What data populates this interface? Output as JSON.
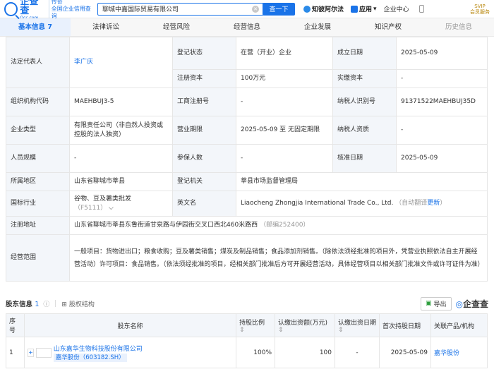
{
  "header": {
    "logo": "企查查",
    "logo_sub": "Qcc.com",
    "logo_side1": "传奇",
    "logo_side2": "全国企业信用查询",
    "search_value": "聊城中嘉国际贸易有限公司",
    "search_btn": "查一下",
    "nav": [
      "知彼阿尔法",
      "应用",
      "企业中心"
    ],
    "vip1": "SVIP",
    "vip2": "会员服务"
  },
  "tabs": [
    "基本信息 7",
    "法律诉讼",
    "经营风险",
    "经营信息",
    "企业发展",
    "知识产权",
    "历史信息"
  ],
  "info": {
    "legal_rep_k": "法定代表人",
    "legal_rep_v": "李广庆",
    "reg_status_k": "登记状态",
    "reg_status_v": "在营（开业）企业",
    "est_date_k": "成立日期",
    "est_date_v": "2025-05-09",
    "reg_cap_k": "注册资本",
    "reg_cap_v": "100万元",
    "paid_cap_k": "实缴资本",
    "paid_cap_v": "-",
    "org_code_k": "组织机构代码",
    "org_code_v": "MAEHBUJ3-5",
    "biz_reg_k": "工商注册号",
    "biz_reg_v": "-",
    "tax_id_k": "纳税人识别号",
    "tax_id_v": "91371522MAEHBUJ35D",
    "type_k": "企业类型",
    "type_v": "有限责任公司（非自然人投资或控股的法人独资）",
    "term_k": "营业期限",
    "term_v": "2025-05-09 至 无固定期限",
    "taxpayer_k": "纳税人资质",
    "taxpayer_v": "-",
    "staff_k": "人员规模",
    "staff_v": "-",
    "insured_k": "参保人数",
    "insured_v": "-",
    "approve_k": "核准日期",
    "approve_v": "2025-05-09",
    "region_k": "所属地区",
    "region_v": "山东省聊城市莘县",
    "authority_k": "登记机关",
    "authority_v": "莘县市场监督管理局",
    "industry_k": "国标行业",
    "industry_v": "谷物、豆及薯类批发",
    "industry_code": "（F5111）",
    "en_name_k": "英文名",
    "en_name_v": "Liaocheng Zhongjia International Trade Co., Ltd.",
    "en_note": "（自动翻译",
    "en_update": "更新",
    "en_close": "）",
    "address_k": "注册地址",
    "address_v": "山东省聊城市莘县东鲁街道甘泉路与伊园街交叉口西北460米路西",
    "postcode": "（邮编252400）",
    "scope_k": "经营范围",
    "scope_v": "一般项目：货物进出口；粮食收购；豆及薯类销售；煤炭及制品销售；食品添加剂销售。（除依法须经批准的项目外，凭营业执照依法自主开展经营活动）许可项目：食品销售。（依法须经批准的项目，经相关部门批准后方可开展经营活动，具体经营项目以相关部门批准文件或许可证件为准）"
  },
  "shareholders": {
    "title": "股东信息",
    "count": "1",
    "struct": "股权结构",
    "export": "导出",
    "brand": "企查查",
    "cols": [
      "序号",
      "股东名称",
      "持股比例",
      "认缴出资额(万元)",
      "认缴出资日期",
      "首次持股日期",
      "关联产品/机构"
    ],
    "rows": [
      {
        "no": "1",
        "name": "山东嘉华生物科技股份有限公司",
        "tag": "嘉华股份（603182.SH）",
        "ratio": "100%",
        "amount": "100",
        "date": "-",
        "first": "2025-05-09",
        "product": "嘉华股份"
      }
    ]
  }
}
